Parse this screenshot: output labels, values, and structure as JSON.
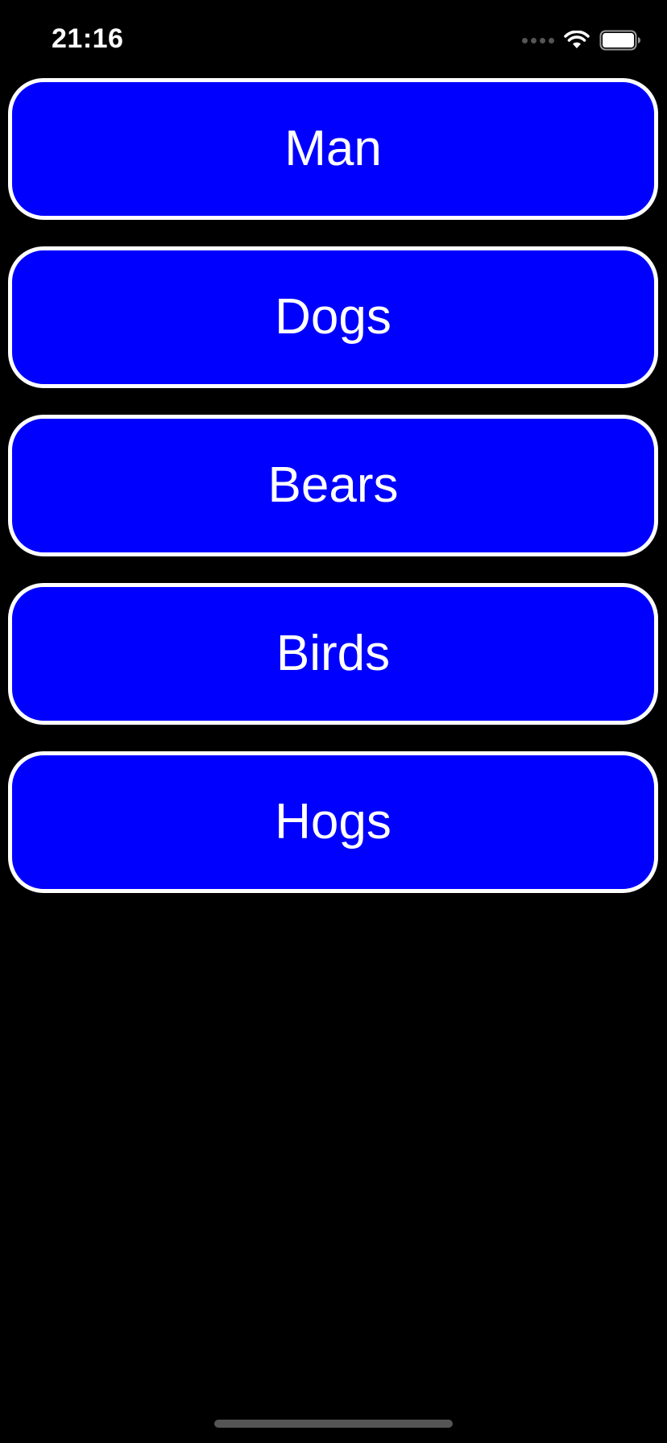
{
  "status_bar": {
    "time": "21:16",
    "signal_icon": "signal-dots-icon",
    "wifi_icon": "wifi-icon",
    "battery_icon": "battery-icon"
  },
  "buttons": [
    {
      "label": "Man"
    },
    {
      "label": "Dogs"
    },
    {
      "label": "Bears"
    },
    {
      "label": "Birds"
    },
    {
      "label": "Hogs"
    }
  ],
  "colors": {
    "background": "#000000",
    "button_fill": "#0000ff",
    "button_border": "#ffffff",
    "text": "#ffffff"
  }
}
